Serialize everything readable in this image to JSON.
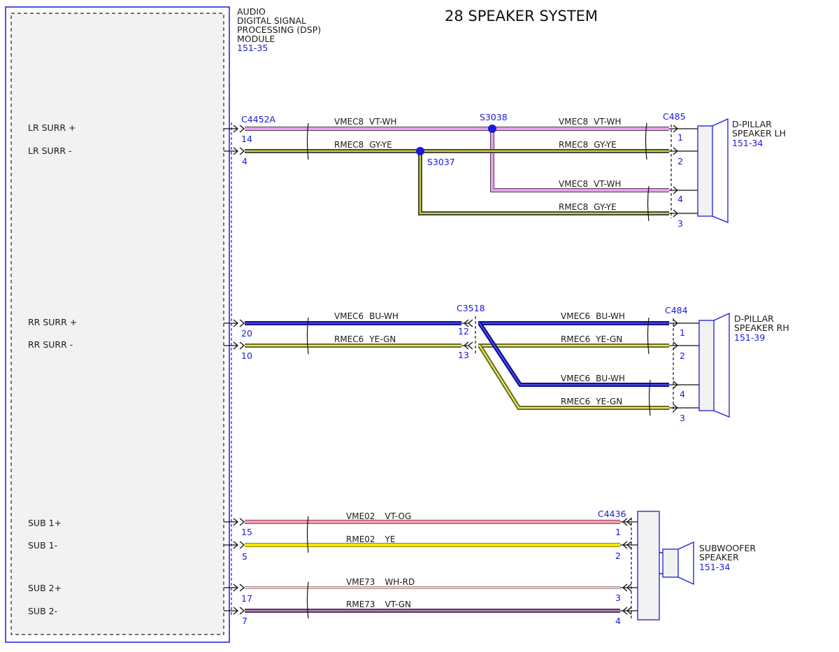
{
  "title": "28 SPEAKER SYSTEM",
  "dsp_module": {
    "name_lines": [
      "AUDIO",
      "DIGITAL SIGNAL",
      "PROCESSING (DSP)",
      "MODULE"
    ],
    "ref": "151-35",
    "pins": [
      {
        "id": "lr-surr-plus",
        "label": "LR SURR +"
      },
      {
        "id": "lr-surr-minus",
        "label": "LR SURR -"
      },
      {
        "id": "rr-surr-plus",
        "label": "RR SURR +"
      },
      {
        "id": "rr-surr-minus",
        "label": "RR SURR -"
      },
      {
        "id": "sub1-plus",
        "label": "SUB 1+"
      },
      {
        "id": "sub1-minus",
        "label": "SUB 1-"
      },
      {
        "id": "sub2-plus",
        "label": "SUB 2+"
      },
      {
        "id": "sub2-minus",
        "label": "SUB 2-"
      }
    ]
  },
  "connectors": {
    "dsp": "C4452A",
    "lh_speaker": "C485",
    "rh_speaker": "C484",
    "rh_inline": "C3518",
    "subwoofer": "C4436"
  },
  "splices": {
    "lr_plus": "S3038",
    "lr_minus": "S3037"
  },
  "speakers": {
    "lh": {
      "name_lines": [
        "D-PILLAR",
        "SPEAKER LH"
      ],
      "ref": "151-34"
    },
    "rh": {
      "name_lines": [
        "D-PILLAR",
        "SPEAKER RH"
      ],
      "ref": "151-39"
    },
    "sub": {
      "name_lines": [
        "SUBWOOFER",
        "SPEAKER"
      ],
      "ref": "151-34"
    }
  },
  "pin_numbers": {
    "dsp": [
      "14",
      "4",
      "20",
      "10",
      "15",
      "5",
      "17",
      "7"
    ],
    "lh": [
      "1",
      "2",
      "4",
      "3"
    ],
    "rh": [
      "1",
      "2",
      "4",
      "3"
    ],
    "c3518": [
      "12",
      "13"
    ],
    "sub": [
      "1",
      "2",
      "3",
      "4"
    ]
  },
  "wires": {
    "lr_plus_a": {
      "circuit": "VMEC8",
      "color": "VT-WH"
    },
    "lr_plus_b": {
      "circuit": "VMEC8",
      "color": "VT-WH"
    },
    "lr_plus_c": {
      "circuit": "VMEC8",
      "color": "VT-WH"
    },
    "lr_minus_a": {
      "circuit": "RMEC8",
      "color": "GY-YE"
    },
    "lr_minus_b": {
      "circuit": "RMEC8",
      "color": "GY-YE"
    },
    "lr_minus_c": {
      "circuit": "RMEC8",
      "color": "GY-YE"
    },
    "rr_plus_a": {
      "circuit": "VMEC6",
      "color": "BU-WH"
    },
    "rr_plus_b": {
      "circuit": "VMEC6",
      "color": "BU-WH"
    },
    "rr_plus_c": {
      "circuit": "VMEC6",
      "color": "BU-WH"
    },
    "rr_minus_a": {
      "circuit": "RMEC6",
      "color": "YE-GN"
    },
    "rr_minus_b": {
      "circuit": "RMEC6",
      "color": "YE-GN"
    },
    "rr_minus_c": {
      "circuit": "RMEC6",
      "color": "YE-GN"
    },
    "sub1_plus": {
      "circuit": "VME02",
      "color": "VT-OG"
    },
    "sub1_minus": {
      "circuit": "RME02",
      "color": "YE"
    },
    "sub2_plus": {
      "circuit": "VME73",
      "color": "WH-RD"
    },
    "sub2_minus": {
      "circuit": "RME73",
      "color": "VT-GN"
    }
  },
  "colors": {
    "outline_blue": "#1a1adc",
    "violet_white": "#e08ee0",
    "grey_yellow_outer": "#5a5a3a",
    "grey_yellow_inner": "#d8d84a",
    "blue_white": "#1a1acc",
    "yellow_green": "#c8d820",
    "violet_orange": "#f08aa8",
    "yellow": "#f0e000",
    "white_red": "#f0a0a0",
    "violet_green": "#9a6aa0"
  }
}
